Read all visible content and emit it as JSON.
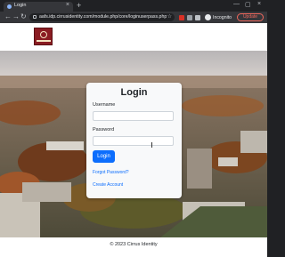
{
  "browser": {
    "tab_title": "Login",
    "tab_close_glyph": "×",
    "new_tab_glyph": "+",
    "window_controls": [
      "—",
      "▢",
      "×"
    ],
    "nav": {
      "back": "←",
      "forward": "→",
      "reload": "↻"
    },
    "url": "aafs.idp.cirrusidentity.com/module.php/core/loginuserpass.php?A...",
    "bookmark_glyph": "☆",
    "profile_label": "Incognito",
    "update_label": "Update",
    "menu_glyph": "⋮",
    "extension_icons": [
      "red-extension-icon",
      "gray-extension-icon",
      "puzzle-icon",
      "sidebar-icon"
    ]
  },
  "header": {
    "logo_name": "university-seal-logo",
    "brand_color": "#8a1c22"
  },
  "login": {
    "title": "Login",
    "username_label": "Username",
    "username_value": "",
    "password_label": "Password",
    "password_value": "",
    "submit_label": "Login",
    "forgot_link": "Forgot Password?",
    "create_link": "Create Account",
    "accent_color": "#0d6efd"
  },
  "footer": {
    "copyright": "© 2023 Cirrus Identity"
  }
}
